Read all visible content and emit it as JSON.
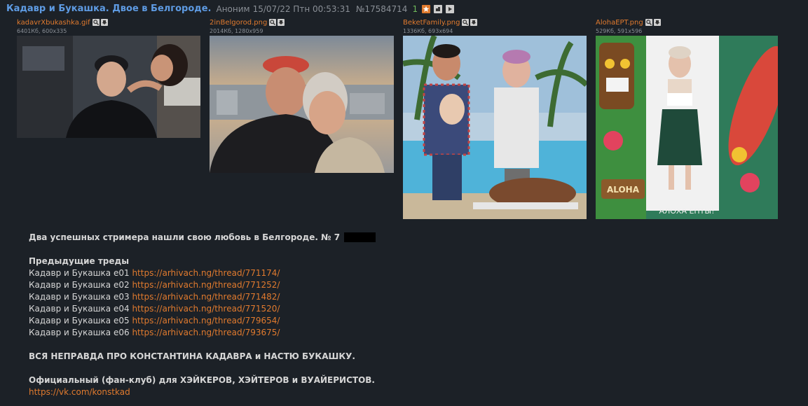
{
  "post": {
    "title": "Кадавр и Букашка. Двое в Белгороде.",
    "author": "Аноним",
    "date": "15/07/22 Птн 00:53:31",
    "number": "№17584714",
    "count": "1",
    "icons": [
      "star-icon",
      "hide-icon",
      "play-icon"
    ]
  },
  "attachments": [
    {
      "name": "kadavrXbukashka.gif",
      "meta": "6401Кб, 600x335",
      "icons": [
        "search-icon",
        "download-icon"
      ]
    },
    {
      "name": "2inBelgorod.png",
      "meta": "2014Кб, 1280x959",
      "icons": [
        "search-icon",
        "download-icon"
      ]
    },
    {
      "name": "BeketFamily.png",
      "meta": "1336Кб, 693x694",
      "icons": [
        "search-icon",
        "download-icon"
      ]
    },
    {
      "name": "AlohaEPT.png",
      "meta": "529Кб, 591x596",
      "icons": [
        "search-icon",
        "download-icon"
      ]
    }
  ],
  "thumbnail_texts": {
    "aloha_sign": "ALOHA",
    "aloha_caption": "АЛОХА ЕПТЫ!"
  },
  "body": {
    "intro": "Два успешных стримера нашли свою любовь в Белгороде. № 7",
    "prev_heading": "Предыдущие треды",
    "threads": [
      {
        "label": "Кадавр и Букашка е01",
        "url": "https://arhivach.ng/thread/771174/"
      },
      {
        "label": "Кадавр и Букашка е02",
        "url": "https://arhivach.ng/thread/771252/"
      },
      {
        "label": "Кадавр и Букашка е03",
        "url": "https://arhivach.ng/thread/771482/"
      },
      {
        "label": "Кадавр и Букашка е04",
        "url": "https://arhivach.ng/thread/771520/"
      },
      {
        "label": "Кадавр и Букашка е05",
        "url": "https://arhivach.ng/thread/779654/"
      },
      {
        "label": "Кадавр и Букашка е06",
        "url": "https://arhivach.ng/thread/793675/"
      }
    ],
    "truth_line": "ВСЯ НЕПРАВДА ПРО КОНСТАНТИНА КАДАВРА и НАСТЮ БУКАШКУ.",
    "club_line": "Официальный (фан-клуб) для ХЭЙКЕРОВ, ХЭЙТЕРОВ и ВУАЙЕРИСТОВ.",
    "club_url": "https://vk.com/konstkad"
  },
  "colors": {
    "background": "#1c2127",
    "title": "#5e9be3",
    "link": "#e07a2e",
    "meta": "#8a8f96",
    "text": "#d6d6d6"
  }
}
